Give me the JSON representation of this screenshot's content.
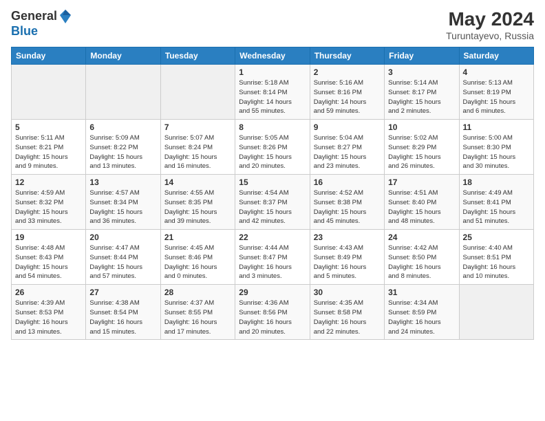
{
  "header": {
    "logo_general": "General",
    "logo_blue": "Blue",
    "month_year": "May 2024",
    "location": "Turuntayevo, Russia"
  },
  "days_of_week": [
    "Sunday",
    "Monday",
    "Tuesday",
    "Wednesday",
    "Thursday",
    "Friday",
    "Saturday"
  ],
  "weeks": [
    [
      {
        "day": "",
        "info": ""
      },
      {
        "day": "",
        "info": ""
      },
      {
        "day": "",
        "info": ""
      },
      {
        "day": "1",
        "info": "Sunrise: 5:18 AM\nSunset: 8:14 PM\nDaylight: 14 hours\nand 55 minutes."
      },
      {
        "day": "2",
        "info": "Sunrise: 5:16 AM\nSunset: 8:16 PM\nDaylight: 14 hours\nand 59 minutes."
      },
      {
        "day": "3",
        "info": "Sunrise: 5:14 AM\nSunset: 8:17 PM\nDaylight: 15 hours\nand 2 minutes."
      },
      {
        "day": "4",
        "info": "Sunrise: 5:13 AM\nSunset: 8:19 PM\nDaylight: 15 hours\nand 6 minutes."
      }
    ],
    [
      {
        "day": "5",
        "info": "Sunrise: 5:11 AM\nSunset: 8:21 PM\nDaylight: 15 hours\nand 9 minutes."
      },
      {
        "day": "6",
        "info": "Sunrise: 5:09 AM\nSunset: 8:22 PM\nDaylight: 15 hours\nand 13 minutes."
      },
      {
        "day": "7",
        "info": "Sunrise: 5:07 AM\nSunset: 8:24 PM\nDaylight: 15 hours\nand 16 minutes."
      },
      {
        "day": "8",
        "info": "Sunrise: 5:05 AM\nSunset: 8:26 PM\nDaylight: 15 hours\nand 20 minutes."
      },
      {
        "day": "9",
        "info": "Sunrise: 5:04 AM\nSunset: 8:27 PM\nDaylight: 15 hours\nand 23 minutes."
      },
      {
        "day": "10",
        "info": "Sunrise: 5:02 AM\nSunset: 8:29 PM\nDaylight: 15 hours\nand 26 minutes."
      },
      {
        "day": "11",
        "info": "Sunrise: 5:00 AM\nSunset: 8:30 PM\nDaylight: 15 hours\nand 30 minutes."
      }
    ],
    [
      {
        "day": "12",
        "info": "Sunrise: 4:59 AM\nSunset: 8:32 PM\nDaylight: 15 hours\nand 33 minutes."
      },
      {
        "day": "13",
        "info": "Sunrise: 4:57 AM\nSunset: 8:34 PM\nDaylight: 15 hours\nand 36 minutes."
      },
      {
        "day": "14",
        "info": "Sunrise: 4:55 AM\nSunset: 8:35 PM\nDaylight: 15 hours\nand 39 minutes."
      },
      {
        "day": "15",
        "info": "Sunrise: 4:54 AM\nSunset: 8:37 PM\nDaylight: 15 hours\nand 42 minutes."
      },
      {
        "day": "16",
        "info": "Sunrise: 4:52 AM\nSunset: 8:38 PM\nDaylight: 15 hours\nand 45 minutes."
      },
      {
        "day": "17",
        "info": "Sunrise: 4:51 AM\nSunset: 8:40 PM\nDaylight: 15 hours\nand 48 minutes."
      },
      {
        "day": "18",
        "info": "Sunrise: 4:49 AM\nSunset: 8:41 PM\nDaylight: 15 hours\nand 51 minutes."
      }
    ],
    [
      {
        "day": "19",
        "info": "Sunrise: 4:48 AM\nSunset: 8:43 PM\nDaylight: 15 hours\nand 54 minutes."
      },
      {
        "day": "20",
        "info": "Sunrise: 4:47 AM\nSunset: 8:44 PM\nDaylight: 15 hours\nand 57 minutes."
      },
      {
        "day": "21",
        "info": "Sunrise: 4:45 AM\nSunset: 8:46 PM\nDaylight: 16 hours\nand 0 minutes."
      },
      {
        "day": "22",
        "info": "Sunrise: 4:44 AM\nSunset: 8:47 PM\nDaylight: 16 hours\nand 3 minutes."
      },
      {
        "day": "23",
        "info": "Sunrise: 4:43 AM\nSunset: 8:49 PM\nDaylight: 16 hours\nand 5 minutes."
      },
      {
        "day": "24",
        "info": "Sunrise: 4:42 AM\nSunset: 8:50 PM\nDaylight: 16 hours\nand 8 minutes."
      },
      {
        "day": "25",
        "info": "Sunrise: 4:40 AM\nSunset: 8:51 PM\nDaylight: 16 hours\nand 10 minutes."
      }
    ],
    [
      {
        "day": "26",
        "info": "Sunrise: 4:39 AM\nSunset: 8:53 PM\nDaylight: 16 hours\nand 13 minutes."
      },
      {
        "day": "27",
        "info": "Sunrise: 4:38 AM\nSunset: 8:54 PM\nDaylight: 16 hours\nand 15 minutes."
      },
      {
        "day": "28",
        "info": "Sunrise: 4:37 AM\nSunset: 8:55 PM\nDaylight: 16 hours\nand 17 minutes."
      },
      {
        "day": "29",
        "info": "Sunrise: 4:36 AM\nSunset: 8:56 PM\nDaylight: 16 hours\nand 20 minutes."
      },
      {
        "day": "30",
        "info": "Sunrise: 4:35 AM\nSunset: 8:58 PM\nDaylight: 16 hours\nand 22 minutes."
      },
      {
        "day": "31",
        "info": "Sunrise: 4:34 AM\nSunset: 8:59 PM\nDaylight: 16 hours\nand 24 minutes."
      },
      {
        "day": "",
        "info": ""
      }
    ]
  ]
}
